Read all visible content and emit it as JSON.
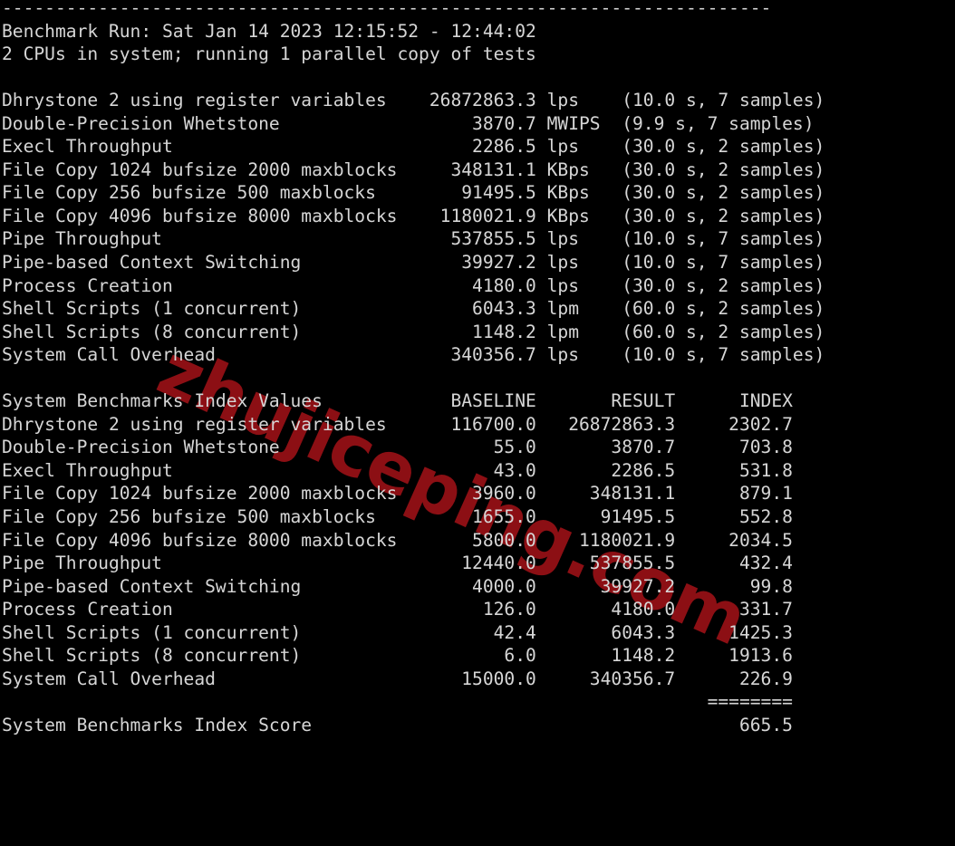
{
  "terminal": {
    "background_color": "#000000",
    "foreground_color": "#d6d6d6",
    "columns": 80
  },
  "watermark": {
    "text": "zhujiceping.com",
    "color": "#8c0f14",
    "rotation_degrees": 24
  },
  "report": {
    "separator_top": "------------------------------------------------------------------------",
    "run_line": "Benchmark Run: Sat Jan 14 2023 12:15:52 - 12:44:02",
    "cpu_line": "2 CPUs in system; running 1 parallel copy of tests"
  },
  "raw_results": {
    "rows": [
      {
        "name": "Dhrystone 2 using register variables",
        "value": "26872863.3",
        "unit": "lps",
        "duration": "10.0 s",
        "samples": "7 samples"
      },
      {
        "name": "Double-Precision Whetstone",
        "value": "3870.7",
        "unit": "MWIPS",
        "duration": "9.9 s",
        "samples": "7 samples"
      },
      {
        "name": "Execl Throughput",
        "value": "2286.5",
        "unit": "lps",
        "duration": "30.0 s",
        "samples": "2 samples"
      },
      {
        "name": "File Copy 1024 bufsize 2000 maxblocks",
        "value": "348131.1",
        "unit": "KBps",
        "duration": "30.0 s",
        "samples": "2 samples"
      },
      {
        "name": "File Copy 256 bufsize 500 maxblocks",
        "value": "91495.5",
        "unit": "KBps",
        "duration": "30.0 s",
        "samples": "2 samples"
      },
      {
        "name": "File Copy 4096 bufsize 8000 maxblocks",
        "value": "1180021.9",
        "unit": "KBps",
        "duration": "30.0 s",
        "samples": "2 samples"
      },
      {
        "name": "Pipe Throughput",
        "value": "537855.5",
        "unit": "lps",
        "duration": "10.0 s",
        "samples": "7 samples"
      },
      {
        "name": "Pipe-based Context Switching",
        "value": "39927.2",
        "unit": "lps",
        "duration": "10.0 s",
        "samples": "7 samples"
      },
      {
        "name": "Process Creation",
        "value": "4180.0",
        "unit": "lps",
        "duration": "30.0 s",
        "samples": "2 samples"
      },
      {
        "name": "Shell Scripts (1 concurrent)",
        "value": "6043.3",
        "unit": "lpm",
        "duration": "60.0 s",
        "samples": "2 samples"
      },
      {
        "name": "Shell Scripts (8 concurrent)",
        "value": "1148.2",
        "unit": "lpm",
        "duration": "60.0 s",
        "samples": "2 samples"
      },
      {
        "name": "System Call Overhead",
        "value": "340356.7",
        "unit": "lps",
        "duration": "10.0 s",
        "samples": "7 samples"
      }
    ]
  },
  "index_table": {
    "title": "System Benchmarks Index Values",
    "headers": {
      "baseline": "BASELINE",
      "result": "RESULT",
      "index": "INDEX"
    },
    "rows": [
      {
        "name": "Dhrystone 2 using register variables",
        "baseline": "116700.0",
        "result": "26872863.3",
        "index": "2302.7"
      },
      {
        "name": "Double-Precision Whetstone",
        "baseline": "55.0",
        "result": "3870.7",
        "index": "703.8"
      },
      {
        "name": "Execl Throughput",
        "baseline": "43.0",
        "result": "2286.5",
        "index": "531.8"
      },
      {
        "name": "File Copy 1024 bufsize 2000 maxblocks",
        "baseline": "3960.0",
        "result": "348131.1",
        "index": "879.1"
      },
      {
        "name": "File Copy 256 bufsize 500 maxblocks",
        "baseline": "1655.0",
        "result": "91495.5",
        "index": "552.8"
      },
      {
        "name": "File Copy 4096 bufsize 8000 maxblocks",
        "baseline": "5800.0",
        "result": "1180021.9",
        "index": "2034.5"
      },
      {
        "name": "Pipe Throughput",
        "baseline": "12440.0",
        "result": "537855.5",
        "index": "432.4"
      },
      {
        "name": "Pipe-based Context Switching",
        "baseline": "4000.0",
        "result": "39927.2",
        "index": "99.8"
      },
      {
        "name": "Process Creation",
        "baseline": "126.0",
        "result": "4180.0",
        "index": "331.7"
      },
      {
        "name": "Shell Scripts (1 concurrent)",
        "baseline": "42.4",
        "result": "6043.3",
        "index": "1425.3"
      },
      {
        "name": "Shell Scripts (8 concurrent)",
        "baseline": "6.0",
        "result": "1148.2",
        "index": "1913.6"
      },
      {
        "name": "System Call Overhead",
        "baseline": "15000.0",
        "result": "340356.7",
        "index": "226.9"
      }
    ],
    "score_rule": "========",
    "score_label": "System Benchmarks Index Score",
    "score_value": "665.5"
  }
}
